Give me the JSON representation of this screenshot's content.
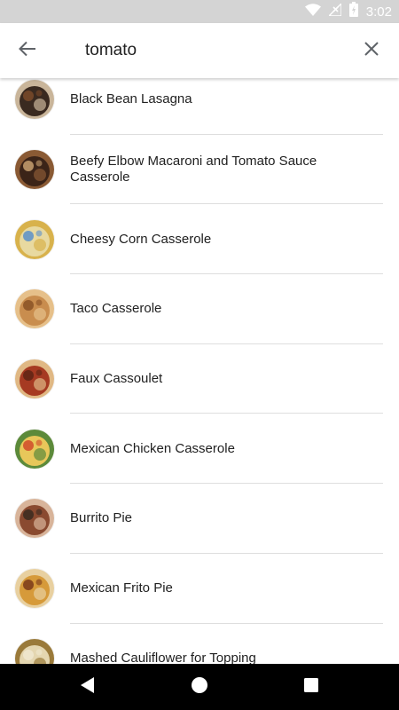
{
  "status_bar": {
    "time": "3:02",
    "icons": [
      "wifi-icon",
      "no-signal-icon",
      "battery-charging-icon"
    ]
  },
  "search": {
    "query": "tomato",
    "back_icon": "arrow-back-icon",
    "clear_icon": "close-icon"
  },
  "results": [
    {
      "title": "Black Bean Lasagna",
      "thumb_colors": [
        "#3a2a20",
        "#c9b59a",
        "#7a4a2a"
      ]
    },
    {
      "title": "Beefy Elbow Macaroni and Tomato Sauce Casserole",
      "thumb_colors": [
        "#3b2418",
        "#8a5a34",
        "#c8a070"
      ]
    },
    {
      "title": "Cheesy Corn Casserole",
      "thumb_colors": [
        "#e8d9a0",
        "#d8b24c",
        "#5b8fc9"
      ]
    },
    {
      "title": "Taco Casserole",
      "thumb_colors": [
        "#c98d4e",
        "#e6c08a",
        "#8a5226"
      ]
    },
    {
      "title": "Faux Cassoulet",
      "thumb_colors": [
        "#a63a22",
        "#e0b884",
        "#5e2414"
      ]
    },
    {
      "title": "Mexican Chicken Casserole",
      "thumb_colors": [
        "#e8c75a",
        "#5c8a3a",
        "#d04a2a"
      ]
    },
    {
      "title": "Burrito Pie",
      "thumb_colors": [
        "#8a4a30",
        "#d8b49a",
        "#3a2a20"
      ]
    },
    {
      "title": "Mexican Frito Pie",
      "thumb_colors": [
        "#d69a3a",
        "#e8d0a0",
        "#7a3a1a"
      ]
    },
    {
      "title": "Mashed Cauliflower for Topping",
      "thumb_colors": [
        "#e4d6b0",
        "#9a7a3a",
        "#f0e8d0"
      ]
    }
  ],
  "nav_bar": {
    "icons": [
      "back-triangle-icon",
      "home-circle-icon",
      "recents-square-icon"
    ]
  },
  "colors": {
    "status_bar_bg": "#d4d4d4",
    "text_primary": "#212121",
    "divider": "#dedede",
    "nav_bar_bg": "#000000"
  }
}
